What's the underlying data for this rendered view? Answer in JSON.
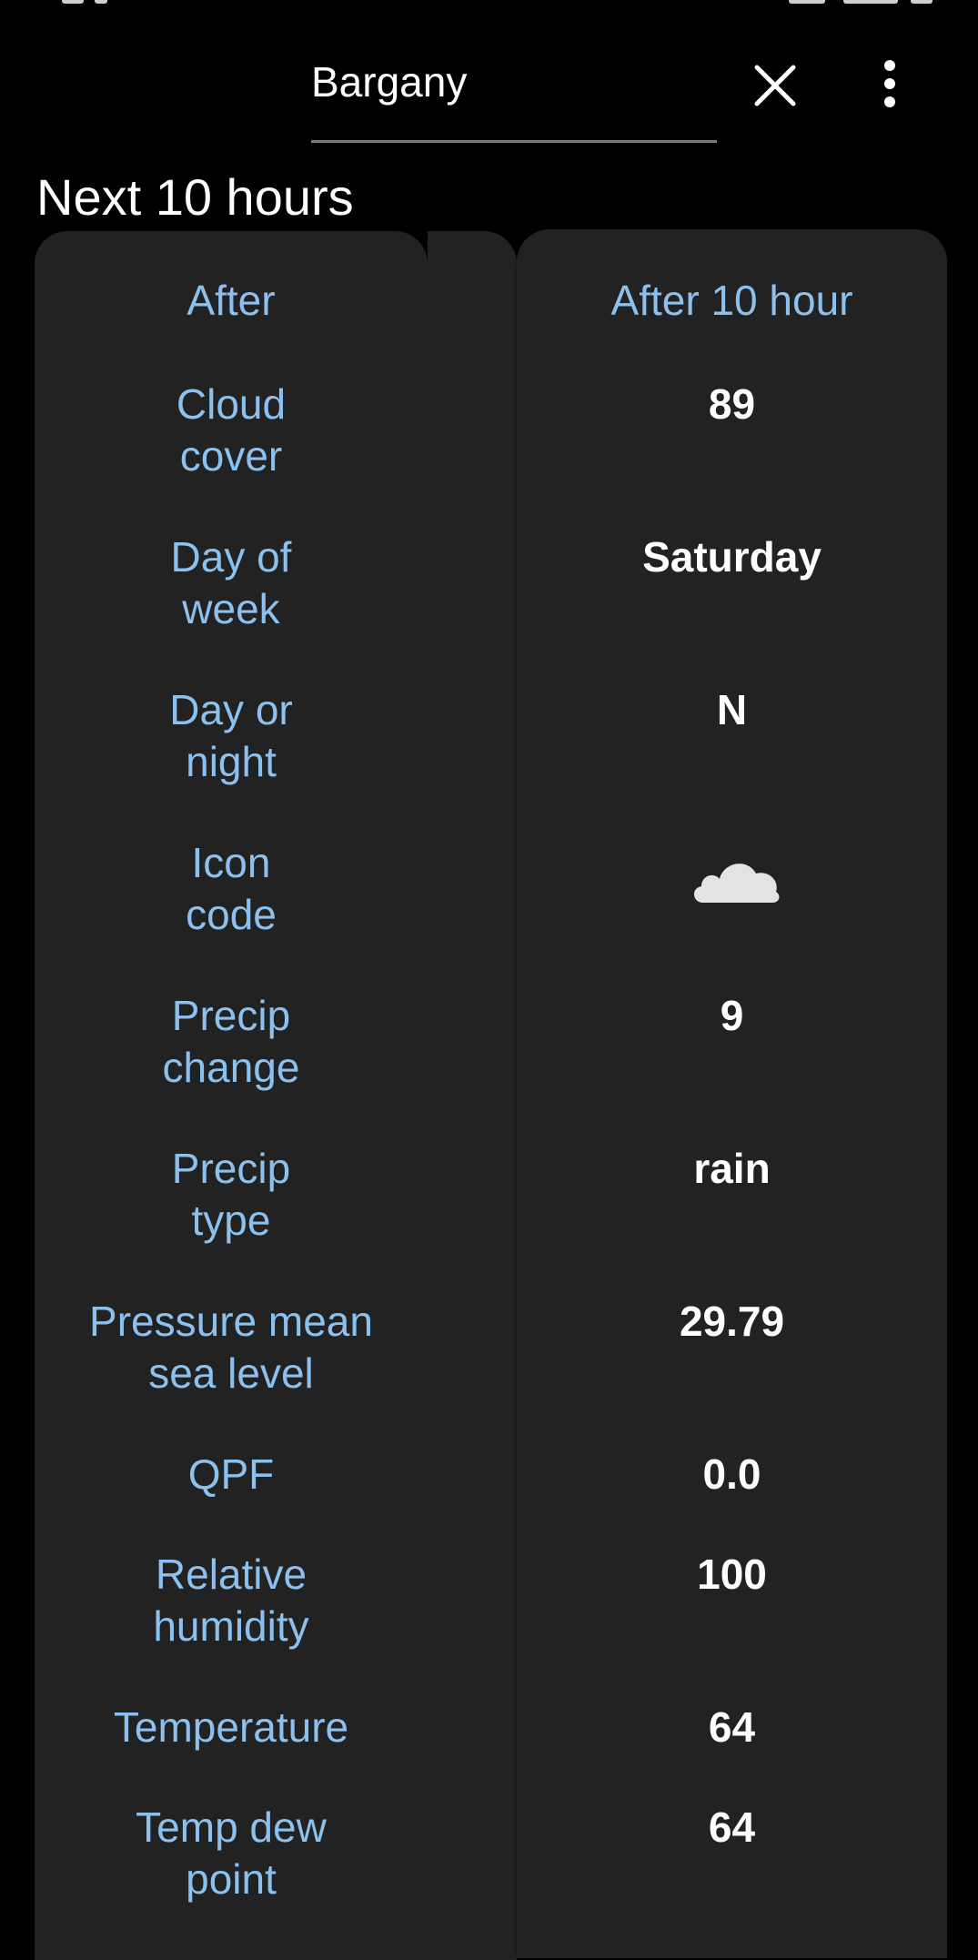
{
  "search": {
    "value": "Bargany"
  },
  "section": {
    "title": "Next 10 hours"
  },
  "table": {
    "header": {
      "label": "After",
      "value": "After 10 hour"
    },
    "rows": [
      {
        "label_line1": "Cloud",
        "label_line2": "cover",
        "value": "89"
      },
      {
        "label_line1": "Day of",
        "label_line2": "week",
        "value": "Saturday"
      },
      {
        "label_line1": "Day or",
        "label_line2": "night",
        "value": "N"
      },
      {
        "label_line1": "Icon",
        "label_line2": "code",
        "icon": "cloud-icon"
      },
      {
        "label_line1": "Precip",
        "label_line2": "change",
        "value": "9"
      },
      {
        "label_line1": "Precip",
        "label_line2": "type",
        "value": "rain"
      },
      {
        "label_line1": "Pressure mean",
        "label_line2": "sea level",
        "value": "29.79"
      },
      {
        "label_line1": "QPF",
        "value": "0.0"
      },
      {
        "label_line1": "Relative",
        "label_line2": "humidity",
        "value": "100"
      },
      {
        "label_line1": "Temperature",
        "value": "64"
      },
      {
        "label_line1": "Temp dew",
        "label_line2": "point",
        "value": "64"
      }
    ]
  },
  "colors": {
    "background": "#000000",
    "panel": "#222222",
    "label": "#8cc0ee",
    "value": "#ffffff"
  }
}
